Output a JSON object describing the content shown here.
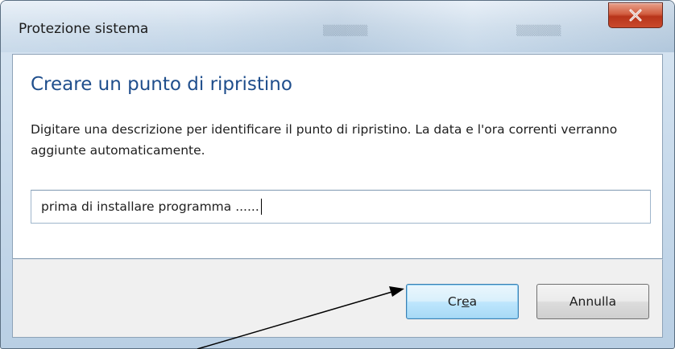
{
  "window": {
    "title": "Protezione sistema",
    "close_icon": "close-icon",
    "accent_close": "#c94a2c"
  },
  "dialog": {
    "heading": "Creare un punto di ripristino",
    "description": "Digitare una descrizione per identificare il punto di ripristino. La data e l'ora correnti verranno aggiunte automaticamente.",
    "input_value": "prima di installare programma ......",
    "heading_color": "#1f4e8c"
  },
  "buttons": {
    "create_pre": "Cr",
    "create_accel": "e",
    "create_post": "a",
    "cancel": "Annulla"
  },
  "annotation": {
    "arrow_icon": "arrow-annotation-icon"
  }
}
